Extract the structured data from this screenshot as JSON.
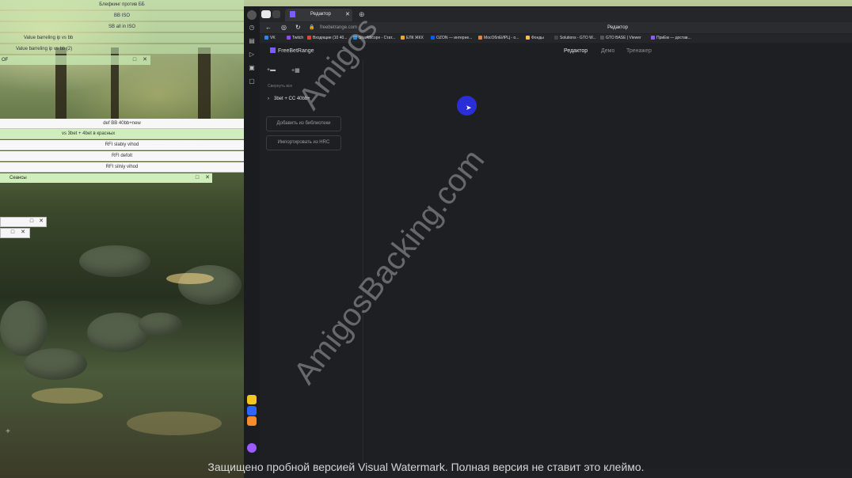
{
  "desktop": {
    "rows_top": [
      "Блефкинг против ББ",
      "BB ISO",
      "SB all in ISO",
      "Value barreling ip vs bb",
      "Value barreling ip vs bb (2)"
    ],
    "window1_title": "OF",
    "rows_middle": [
      "def BB 40bb+new",
      "vs 3bet + 4bet в красных",
      "RFI slabiy vihod",
      "RFI defolt",
      "RFI silniy vihod"
    ],
    "window2_title": "Сеансы",
    "window_controls": {
      "maximize": "□",
      "close": "✕"
    }
  },
  "browser": {
    "tab_title": "Редактор",
    "url": "freebetrange.com",
    "page_title": "Редактор",
    "bookmarks": [
      {
        "label": "VK",
        "color": "#2787f5"
      },
      {
        "label": "Twitch",
        "color": "#9146ff"
      },
      {
        "label": "Входящие (10 40...",
        "color": "#ea4335"
      },
      {
        "label": "SharkScope - Стат...",
        "color": "#1c8adb"
      },
      {
        "label": "ЕЛК ЖКХ",
        "color": "#f5a623"
      },
      {
        "label": "OZON — интерне...",
        "color": "#005bff"
      },
      {
        "label": "МосОблЕИРЦ - о...",
        "color": "#e8813a"
      },
      {
        "label": "Фонды",
        "color": "#f6c343"
      },
      {
        "label": "Solutions - GTO W...",
        "color": "#444444"
      },
      {
        "label": "GTO BASE | Viewer",
        "color": "#555555"
      },
      {
        "label": "ПриЕм — достав...",
        "color": "#8b5cf6"
      }
    ]
  },
  "app": {
    "logo": "FreeBetRange",
    "nav": [
      "Редактор",
      "Демо",
      "Тренажер"
    ],
    "active_nav": "Редактор",
    "collapse_all": "Свернуть все",
    "tree_item": "3bet + CC 40bb+",
    "add_from_library": "Добавить из библиотеки",
    "import_hrc": "Импортировать из HRC"
  },
  "overlay": {
    "watermark": "AmigosBacking.com",
    "watermark_partial": "Amigos",
    "notice": "Защищено пробной версией Visual Watermark. Полная версия не ставит это клеймо."
  },
  "colors": {
    "accent": "#7b5cff",
    "cursor": "#2a2ed8",
    "green_row": "#cfeebc"
  }
}
